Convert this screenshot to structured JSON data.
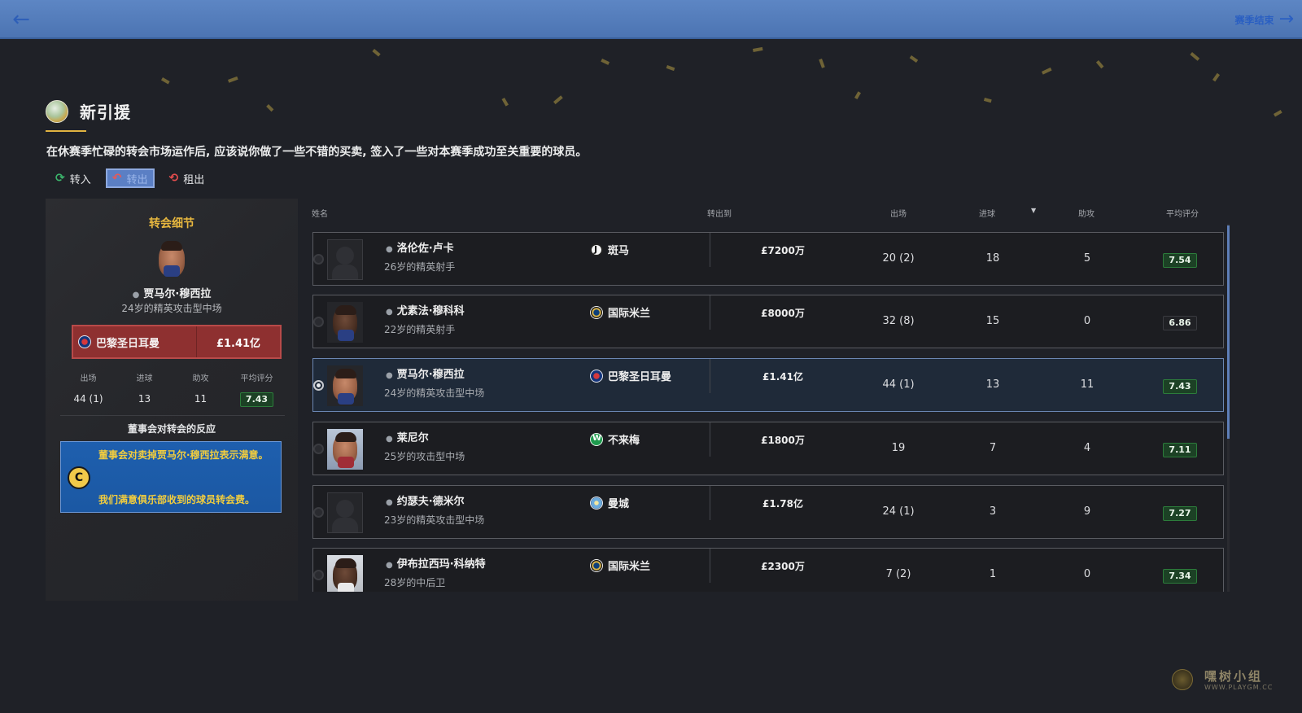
{
  "topbar": {
    "next_label": "赛季结束"
  },
  "section": {
    "title": "新引援",
    "description": "在休赛季忙碌的转会市场运作后, 应该说你做了一些不错的买卖, 签入了一些对本赛季成功至关重要的球员。"
  },
  "tabs": [
    {
      "label": "转入"
    },
    {
      "label": "转出"
    },
    {
      "label": "租出"
    }
  ],
  "detail": {
    "title": "转会细节",
    "player_name": "贾马尔·穆西拉",
    "player_desc": "24岁的精英攻击型中场",
    "club": "巴黎圣日耳曼",
    "fee": "£1.41亿",
    "stats": [
      {
        "label": "出场",
        "value": "44 (1)"
      },
      {
        "label": "进球",
        "value": "13"
      },
      {
        "label": "助攻",
        "value": "11"
      },
      {
        "label": "平均评分",
        "value": "7.43"
      }
    ],
    "board_title": "董事会对转会的反应",
    "board_icon": "C",
    "board_line1": "董事会对卖掉贾马尔·穆西拉表示满意。",
    "board_line2": "我们满意俱乐部收到的球员转会费。"
  },
  "table": {
    "headers": {
      "name": "姓名",
      "to": "转出到",
      "apps": "出场",
      "goals": "进球",
      "assists": "助攻",
      "rating": "平均评分"
    },
    "rows": [
      {
        "name": "洛伦佐·卢卡",
        "desc": "26岁的精英射手",
        "club": "斑马",
        "fee": "£7200万",
        "apps": "20 (2)",
        "goals": "18",
        "assists": "5",
        "rating": "7.54"
      },
      {
        "name": "尤素法·穆科科",
        "desc": "22岁的精英射手",
        "club": "国际米兰",
        "fee": "£8000万",
        "apps": "32 (8)",
        "goals": "15",
        "assists": "0",
        "rating": "6.86"
      },
      {
        "name": "贾马尔·穆西拉",
        "desc": "24岁的精英攻击型中场",
        "club": "巴黎圣日耳曼",
        "fee": "£1.41亿",
        "apps": "44 (1)",
        "goals": "13",
        "assists": "11",
        "rating": "7.43"
      },
      {
        "name": "莱尼尔",
        "desc": "25岁的攻击型中场",
        "club": "不来梅",
        "fee": "£1800万",
        "apps": "19",
        "goals": "7",
        "assists": "4",
        "rating": "7.11"
      },
      {
        "name": "约瑟夫·德米尔",
        "desc": "23岁的精英攻击型中场",
        "club": "曼城",
        "fee": "£1.78亿",
        "apps": "24 (1)",
        "goals": "3",
        "assists": "9",
        "rating": "7.27"
      },
      {
        "name": "伊布拉西玛·科纳特",
        "desc": "28岁的中后卫",
        "club": "国际米兰",
        "fee": "£2300万",
        "apps": "7 (2)",
        "goals": "1",
        "assists": "0",
        "rating": "7.34"
      }
    ]
  },
  "watermark": {
    "name": "嘿树小组",
    "url": "WWW.PLAYGM.CC"
  },
  "colors": {
    "accent_gold": "#e7b73f",
    "topbar_blue": "#5d86c4",
    "fee_red": "#8e3030",
    "board_blue": "#1e5fae",
    "rating_green": "#2c7c3b"
  }
}
